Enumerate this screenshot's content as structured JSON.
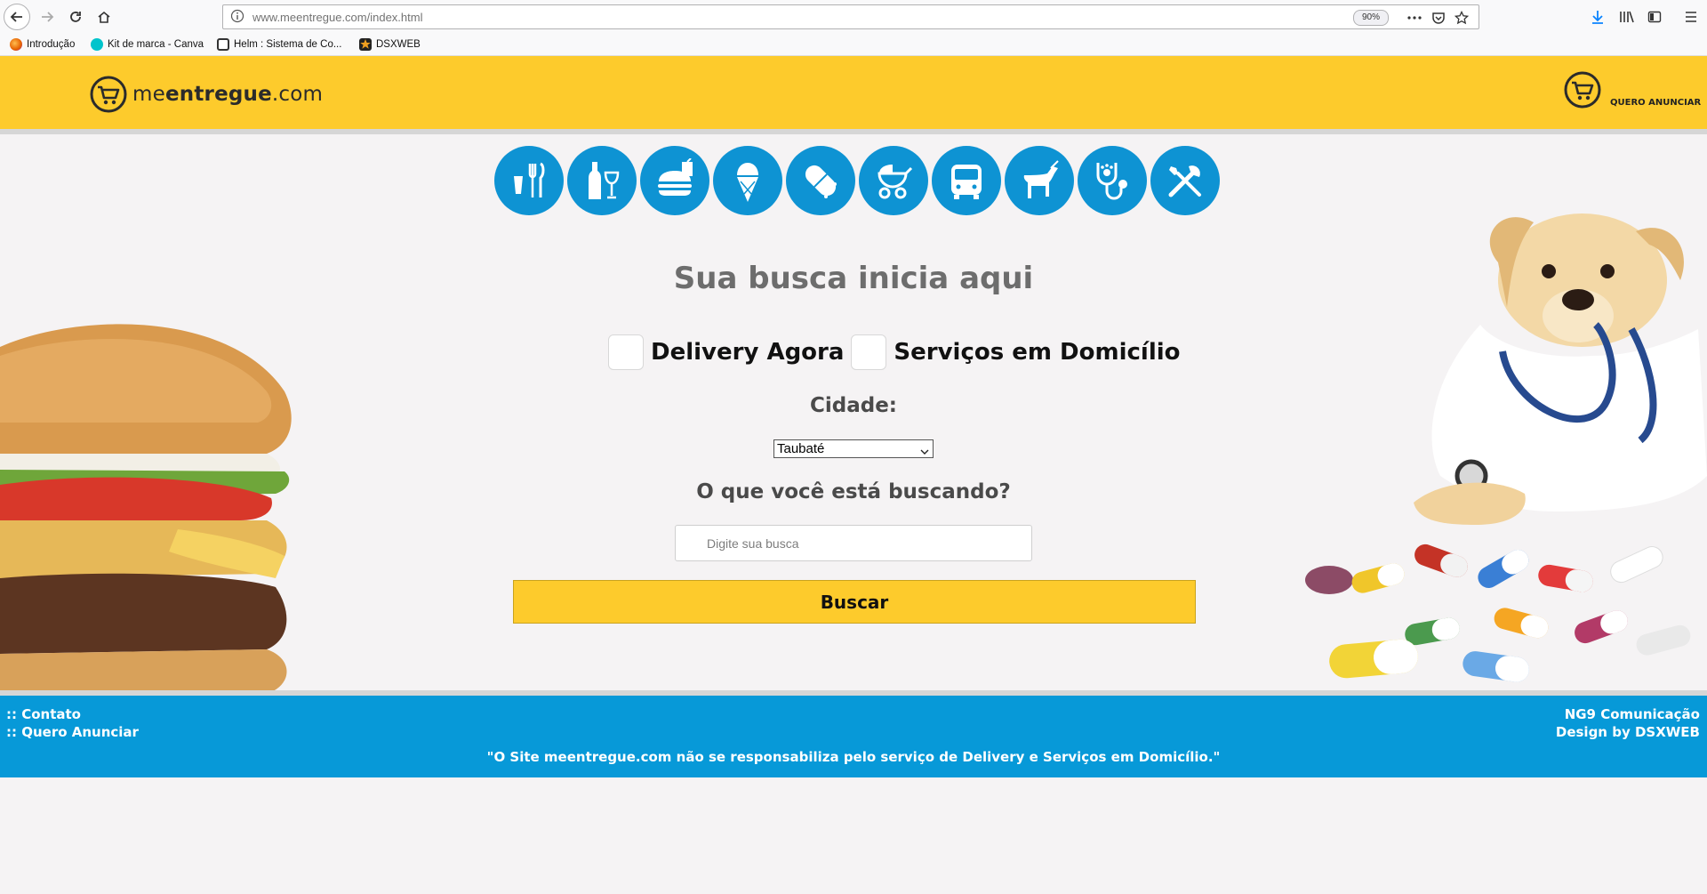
{
  "browser": {
    "url": "www.meentregue.com/index.html",
    "zoom": "90%",
    "bookmarks": [
      {
        "label": "Introdução",
        "icon": "firefox-icon",
        "color": "#e66000"
      },
      {
        "label": "Kit de marca - Canva",
        "icon": "canva-icon",
        "color": "#00c4cc"
      },
      {
        "label": "Helm : Sistema de Co...",
        "icon": "helm-icon",
        "color": "#333333"
      },
      {
        "label": "DSXWEB",
        "icon": "dsxweb-icon",
        "color": "#222222"
      }
    ]
  },
  "header": {
    "logo_prefix": "me",
    "logo_bold": "entregue",
    "logo_suffix": ".com",
    "quero_anunciar": "QUERO ANUNCIAR"
  },
  "categories": [
    "restaurant-icon",
    "wine-icon",
    "fast-food-icon",
    "ice-cream-icon",
    "pharmacy-icon",
    "baby-stroller-icon",
    "bus-icon",
    "dog-walk-icon",
    "veterinary-icon",
    "tools-icon"
  ],
  "main": {
    "title": "Sua busca inicia aqui",
    "option_delivery": "Delivery Agora",
    "option_services": "Serviços em Domicílio",
    "city_label": "Cidade:",
    "city_selected": "Taubaté",
    "query_label": "O que você está buscando?",
    "search_placeholder": "Digite sua busca",
    "search_button": "Buscar"
  },
  "footer": {
    "link_contato": ":: Contato",
    "link_anunciar": ":: Quero Anunciar",
    "credit_line1": "NG9 Comunicação",
    "credit_line2": "Design by DSXWEB",
    "disclaimer": "\"O Site meentregue.com não se responsabiliza pelo serviço de Delivery e Serviços em Domicílio.\""
  },
  "colors": {
    "brand_yellow": "#fdcb2c",
    "brand_blue": "#0799d8",
    "icon_blue": "#0e93d3"
  }
}
